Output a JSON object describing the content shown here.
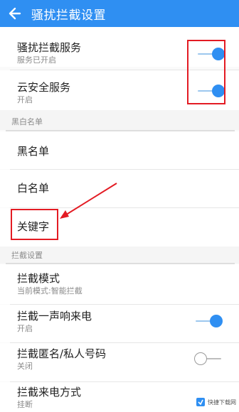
{
  "header": {
    "title": "骚扰拦截设置",
    "back_icon": "arrow-left-icon",
    "color": "#2f8ff2"
  },
  "services": {
    "items": [
      {
        "title": "骚扰拦截服务",
        "subtitle": "服务已开启",
        "toggle": "on"
      },
      {
        "title": "云安全服务",
        "subtitle": "开启",
        "toggle": "on"
      }
    ]
  },
  "lists_section": {
    "label": "黑白名单",
    "items": [
      {
        "title": "黑名单"
      },
      {
        "title": "白名单"
      },
      {
        "title": "关键字"
      }
    ]
  },
  "intercept_section": {
    "label": "拦截设置",
    "items": [
      {
        "title": "拦截模式",
        "subtitle": "当前模式:智能拦截"
      },
      {
        "title": "拦截一声响来电",
        "subtitle": "开启",
        "toggle": "on"
      },
      {
        "title": "拦截匿名/私人号码",
        "subtitle": "关闭",
        "toggle": "off"
      },
      {
        "title": "拦截来电方式",
        "subtitle": "挂断"
      }
    ]
  },
  "annotation": {
    "color": "#e31b23"
  },
  "watermark": {
    "text": "快捷下载网"
  }
}
